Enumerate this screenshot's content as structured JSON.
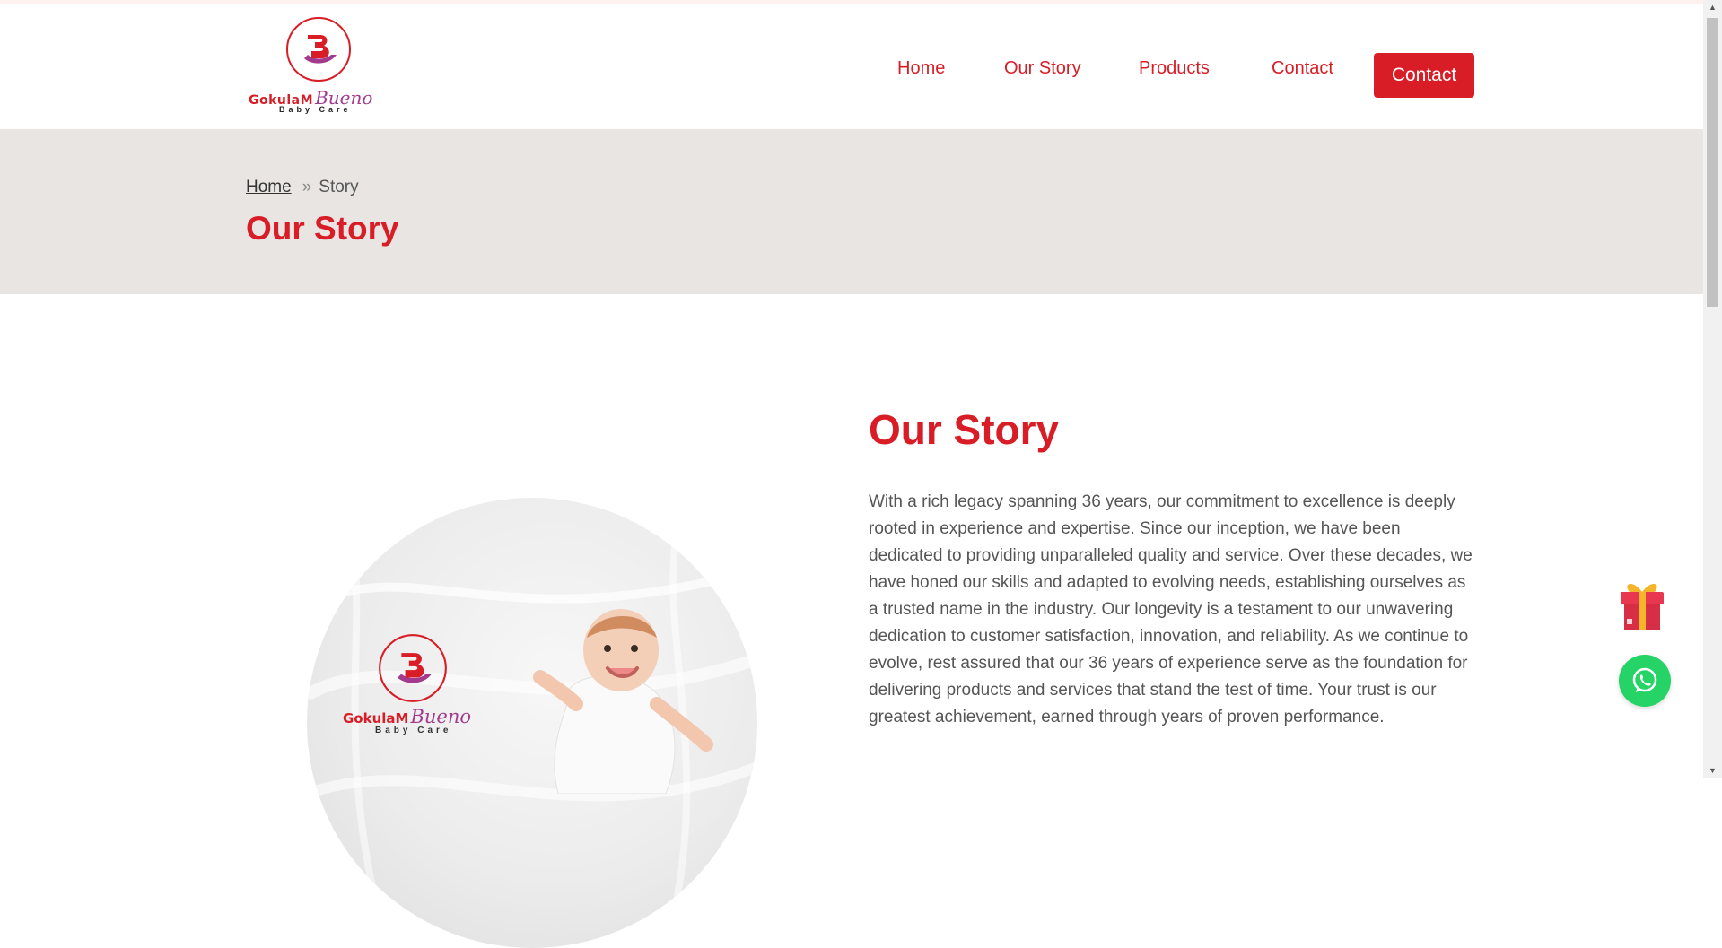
{
  "brand": {
    "monogram": "GB",
    "name_part1": "GokulaM",
    "name_part2": "Bueno",
    "tagline": "Baby Care",
    "primary_color": "#d81d26",
    "secondary_color": "#a23a8e"
  },
  "nav": {
    "items": [
      {
        "label": "Home"
      },
      {
        "label": "Our Story"
      },
      {
        "label": "Products"
      },
      {
        "label": "Contact"
      }
    ],
    "cta_label": "Contact"
  },
  "page_header": {
    "breadcrumb": {
      "home": "Home",
      "separator": "»",
      "current": "Story"
    },
    "title": "Our Story",
    "background": "#e8e5e3"
  },
  "main": {
    "title": "Our Story",
    "body": "With a rich legacy spanning 36 years, our commitment to excellence is deeply rooted in experience and expertise. Since our inception, we have been dedicated to providing unparalleled quality and service. Over these decades, we have honed our skills and adapted to evolving needs, establishing ourselves as a trusted name in the industry. Our longevity is a testament to our unwavering dedication to customer satisfaction, innovation, and reliability. As we continue to evolve, rest assured that our 36 years of experience serve as the foundation for delivering products and services that stand the test of time. Your trust is our greatest achievement, earned through years of proven performance."
  },
  "widgets": {
    "gift_icon": "gift-icon",
    "whatsapp_icon": "whatsapp-icon",
    "whatsapp_color": "#25d366"
  }
}
